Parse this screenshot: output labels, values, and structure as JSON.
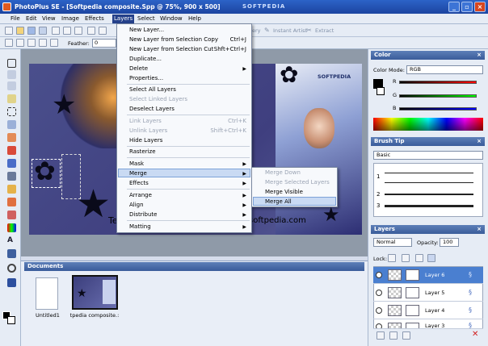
{
  "app": {
    "title": "PhotoPlus SE - [Softpedia composite.Spp @ 75%, 900 x 500]",
    "watermark": "SOFTPEDIA",
    "window_buttons": [
      "_",
      "▫",
      "×"
    ]
  },
  "menubar": [
    "File",
    "Edit",
    "View",
    "Image",
    "Effects",
    "Layers",
    "Select",
    "Window",
    "Help"
  ],
  "toolbar": {
    "instant_artist": "Instant Artist",
    "extract": "Extract"
  },
  "context_bar": {
    "feather_label": "Feather:",
    "feather_value": "0"
  },
  "canvas": {
    "text_left": "Te",
    "text_right": "softpedia.com",
    "logo_small": "SOFTPEDIA"
  },
  "layers_menu": {
    "items": [
      {
        "label": "New Layer...",
        "shortcut": ""
      },
      {
        "label": "New Layer from Selection Copy",
        "shortcut": "Ctrl+J"
      },
      {
        "label": "New Layer from Selection Cut",
        "shortcut": "Shft+Ctrl+J"
      },
      {
        "label": "Duplicate...",
        "shortcut": ""
      },
      {
        "label": "Delete",
        "shortcut": ""
      },
      {
        "label": "Properties...",
        "shortcut": ""
      },
      {
        "label": "Select All Layers",
        "shortcut": ""
      },
      {
        "label": "Select Linked Layers",
        "shortcut": "",
        "disabled": true
      },
      {
        "label": "Deselect Layers",
        "shortcut": ""
      },
      {
        "label": "Link Layers",
        "shortcut": "Ctrl+K",
        "disabled": true
      },
      {
        "label": "Unlink Layers",
        "shortcut": "Shift+Ctrl+K",
        "disabled": true
      },
      {
        "label": "Hide Layers",
        "shortcut": ""
      },
      {
        "label": "Rasterize",
        "shortcut": ""
      },
      {
        "label": "Mask",
        "shortcut": ""
      },
      {
        "label": "Merge",
        "shortcut": ""
      },
      {
        "label": "Effects",
        "shortcut": ""
      },
      {
        "label": "Arrange",
        "shortcut": ""
      },
      {
        "label": "Align",
        "shortcut": ""
      },
      {
        "label": "Distribute",
        "shortcut": ""
      },
      {
        "label": "Matting",
        "shortcut": ""
      }
    ]
  },
  "merge_submenu": {
    "items": [
      {
        "label": "Merge Down",
        "disabled": true
      },
      {
        "label": "Merge Selected Layers",
        "disabled": true
      },
      {
        "label": "Merge Visible"
      },
      {
        "label": "Merge All"
      }
    ]
  },
  "documents": {
    "title": "Documents",
    "items": [
      {
        "caption": "Untitled1"
      },
      {
        "caption": "tpedia composite.:"
      }
    ]
  },
  "color_panel": {
    "title": "Color",
    "mode_label": "Color Mode:",
    "mode_value": "RGB",
    "channels": [
      "R",
      "G",
      "B"
    ]
  },
  "brush_panel": {
    "title": "Brush Tip",
    "preset": "Basic",
    "sizes": [
      "1",
      "2",
      "3"
    ]
  },
  "layers_panel": {
    "title": "Layers",
    "blend_mode": "Normal",
    "opacity_label": "Opacity:",
    "opacity_value": "100",
    "lock_label": "Lock:",
    "layers": [
      {
        "name": "Layer 6"
      },
      {
        "name": "Layer 5"
      },
      {
        "name": "Layer 4"
      },
      {
        "name": "Layer 3"
      }
    ]
  },
  "colors": {
    "titlebar": "#1c44a0",
    "panel_header": "#3a5c9a",
    "selected_layer": "#4a7fd0",
    "menu_highlight": "#c9daf3"
  }
}
